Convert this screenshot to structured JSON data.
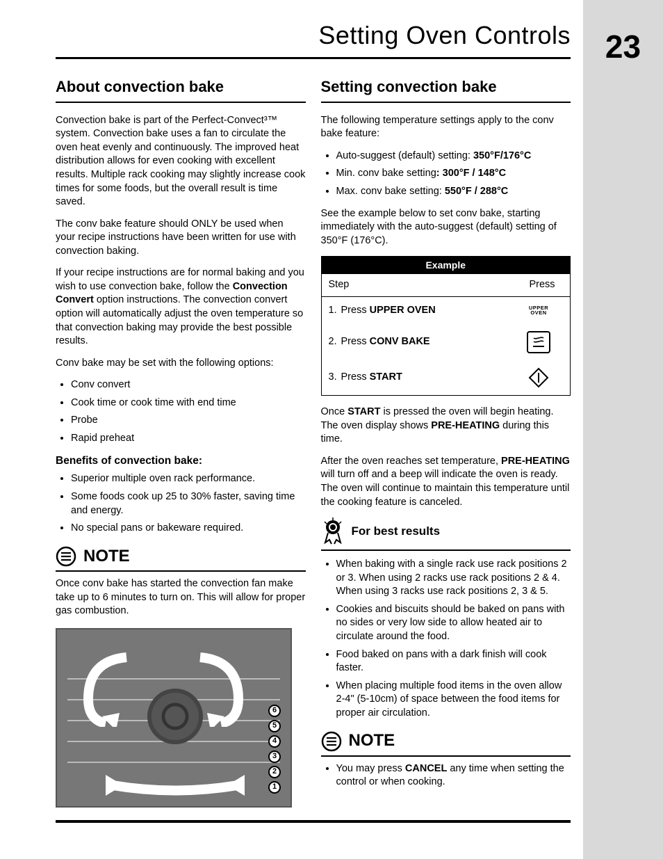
{
  "page": {
    "title": "Setting Oven Controls",
    "number": "23"
  },
  "left": {
    "heading": "About convection bake",
    "p1": "Convection bake is part of the Perfect-Convect³™ system. Convection bake uses a fan to circulate the oven heat evenly and continuously. The improved heat distribution allows for even cooking with excellent results. Multiple rack cooking may slightly increase cook times for some foods, but the overall result is time saved.",
    "p2": "The conv bake feature should ONLY be used when your recipe instructions have been written for use with convection baking.",
    "p3a": "If your recipe instructions are for normal baking and you wish to use convection bake, follow the ",
    "p3b": "Convection Convert",
    "p3c": " option instructions. The convection convert option will automatically adjust the oven temperature so that convection baking may provide the best possible results.",
    "p4": "Conv bake may be set with the following options:",
    "options": [
      "Conv convert",
      "Cook time or cook time with end time",
      "Probe",
      "Rapid preheat"
    ],
    "benefits_head": "Benefits of convection bake:",
    "benefits": [
      "Superior multiple oven rack performance.",
      "Some foods cook up 25 to 30% faster, saving time and energy.",
      "No special pans or bakeware required."
    ],
    "note_label": "NOTE",
    "note_text": "Once conv bake has started the convection fan make take up to 6 minutes to turn on. This will allow for proper gas combustion.",
    "rack_labels": [
      "6",
      "5",
      "4",
      "3",
      "2",
      "1"
    ]
  },
  "right": {
    "heading": "Setting convection bake",
    "intro": "The following temperature settings apply to the conv bake feature:",
    "settings": [
      {
        "pre": "Auto-suggest (default) setting: ",
        "val": "350°F/176°C"
      },
      {
        "pre": "Min. conv bake setting",
        "val": ": 300°F / 148°C"
      },
      {
        "pre": "Max. conv bake setting: ",
        "val": "550°F / 288°C"
      }
    ],
    "see_example": "See the example below to set conv bake, starting immediately with the auto-suggest (default) setting of 350°F (176°C).",
    "table": {
      "header": "Example",
      "col1": "Step",
      "col2": "Press",
      "rows": [
        {
          "n": "1.",
          "pre": "Press ",
          "strong": "UPPER OVEN",
          "icon": "upper-oven",
          "upper_oven_txt": "UPPER\nOVEN"
        },
        {
          "n": "2.",
          "pre": "Press ",
          "strong": "CONV BAKE",
          "icon": "conv-bake"
        },
        {
          "n": "3.",
          "pre": "Press ",
          "strong": "START",
          "icon": "start"
        }
      ]
    },
    "after1a": "Once ",
    "after1b": "START",
    "after1c": " is pressed the oven will begin heating. The oven display shows ",
    "after1d": "PRE-HEATING",
    "after1e": " during this time.",
    "after2a": "After the oven reaches set temperature, ",
    "after2b": "PRE-HEATING",
    "after2c": " will turn off and a beep will indicate the oven is ready. The oven will continue to maintain this temperature until the cooking feature is canceled.",
    "best_label": "For best results",
    "best_items": [
      "When baking with a single rack use rack positions 2 or 3. When using 2 racks use rack positions 2 & 4. When using 3 racks use rack positions 2, 3 & 5.",
      "Cookies and biscuits should be baked on pans with no sides or very low side to allow heated air to circulate around the food.",
      "Food baked on pans with a dark finish will cook faster.",
      "When placing multiple food items in the oven allow 2-4\" (5-10cm) of space between the food items for proper air circulation."
    ],
    "note_label": "NOTE",
    "note_item_a": "You may press ",
    "note_item_b": "CANCEL",
    "note_item_c": " any time when setting the control or when cooking."
  }
}
